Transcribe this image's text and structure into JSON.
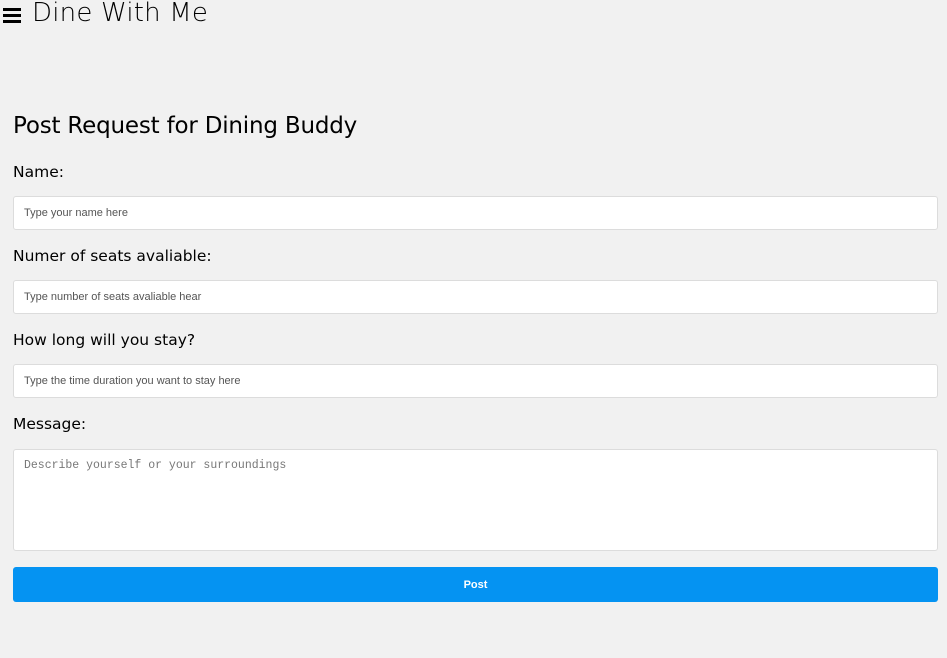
{
  "header": {
    "menu_icon": "hamburger-menu-icon",
    "title": "Dine With Me"
  },
  "form": {
    "title": "Post Request for Dining Buddy",
    "name": {
      "label": "Name:",
      "value": "",
      "placeholder": "Type your name here"
    },
    "seats": {
      "label": "Numer of seats avaliable:",
      "value": "",
      "placeholder": "Type number of seats avaliable hear"
    },
    "duration": {
      "label": "How long will you stay?",
      "value": "",
      "placeholder": "Type the time duration you want to stay here"
    },
    "message": {
      "label": "Message:",
      "value": "",
      "placeholder": "Describe yourself or your surroundings"
    },
    "submit_label": "Post"
  },
  "colors": {
    "background": "#f1f1f1",
    "button": "#0593f2",
    "button_text": "#ffffff"
  }
}
